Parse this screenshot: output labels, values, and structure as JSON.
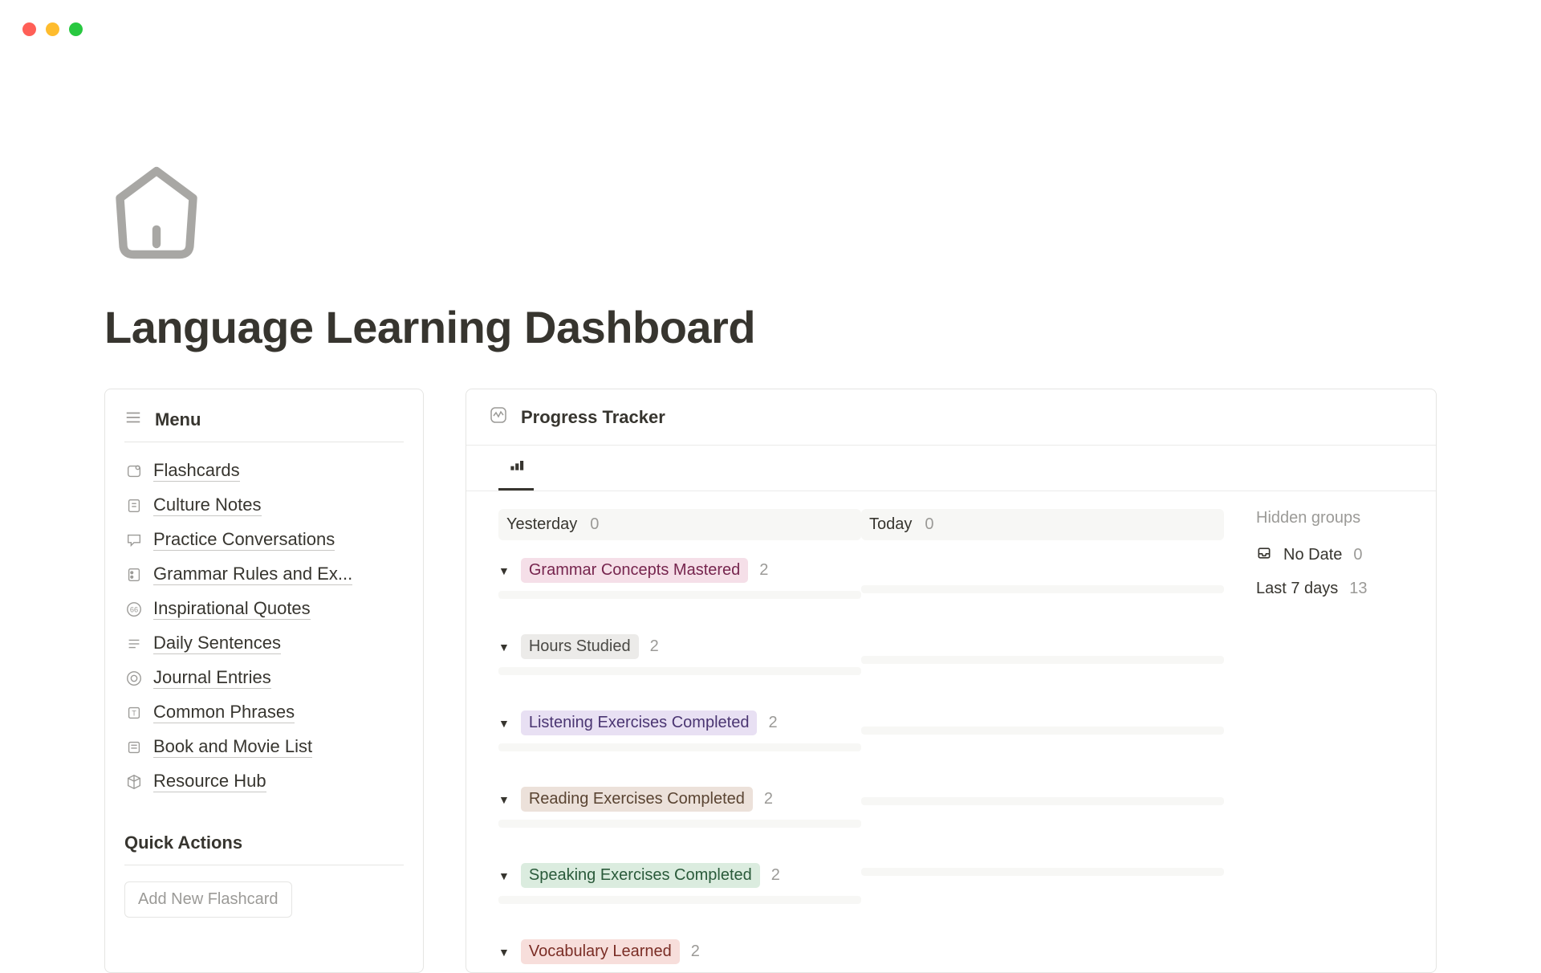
{
  "page": {
    "title": "Language Learning Dashboard"
  },
  "sidebar": {
    "menu_title": "Menu",
    "items": [
      {
        "label": "Flashcards"
      },
      {
        "label": "Culture Notes"
      },
      {
        "label": "Practice Conversations"
      },
      {
        "label": "Grammar Rules and Ex..."
      },
      {
        "label": "Inspirational Quotes"
      },
      {
        "label": "Daily Sentences"
      },
      {
        "label": "Journal Entries"
      },
      {
        "label": "Common Phrases"
      },
      {
        "label": "Book and Movie List"
      },
      {
        "label": "Resource Hub"
      }
    ],
    "quick_actions_title": "Quick Actions",
    "add_flashcard_label": "Add New Flashcard"
  },
  "tracker": {
    "title": "Progress Tracker",
    "columns": {
      "yesterday": {
        "label": "Yesterday",
        "count": "0"
      },
      "today": {
        "label": "Today",
        "count": "0"
      }
    },
    "hidden_label": "Hidden groups",
    "no_date": {
      "label": "No Date",
      "count": "0"
    },
    "last_7": {
      "label": "Last 7 days",
      "count": "13"
    },
    "categories": [
      {
        "label": "Grammar Concepts Mastered",
        "count": "2",
        "color": "pink"
      },
      {
        "label": "Hours Studied",
        "count": "2",
        "color": "grey"
      },
      {
        "label": "Listening Exercises Completed",
        "count": "2",
        "color": "purple"
      },
      {
        "label": "Reading Exercises Completed",
        "count": "2",
        "color": "brown"
      },
      {
        "label": "Speaking Exercises Completed",
        "count": "2",
        "color": "green"
      },
      {
        "label": "Vocabulary Learned",
        "count": "2",
        "color": "red"
      }
    ]
  }
}
